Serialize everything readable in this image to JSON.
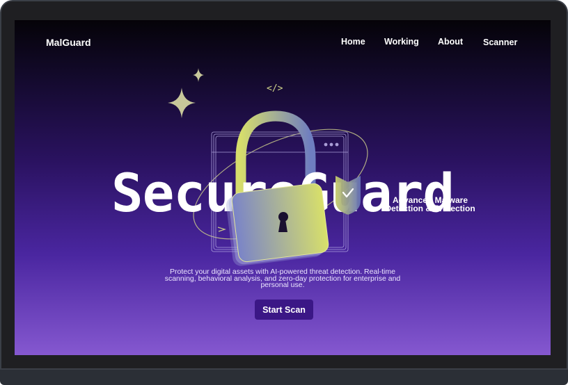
{
  "brand": "MalGuard",
  "nav": {
    "items": [
      {
        "label": "Home"
      },
      {
        "label": "Working"
      },
      {
        "label": "About"
      },
      {
        "label": "Scanner"
      }
    ]
  },
  "hero": {
    "title": "SecureGuard",
    "subtitle": "Advanced Malware Detection & Protection",
    "description": "Protect your digital assets with AI-powered threat detection. Real-time scanning, behavioral analysis, and zero-day protection for enterprise and personal use.",
    "cta_label": "Start Scan",
    "code_glyph": "</>"
  },
  "icons": [
    "sparkle-icon",
    "code-icon",
    "padlock-icon",
    "shield-check-icon",
    "browser-window-icon"
  ],
  "colors": {
    "accent": "#3b1786",
    "lock_gradient_start": "#7a84c8",
    "lock_gradient_end": "#d8e06a",
    "background_top": "#050308",
    "background_bottom": "#8558d0"
  }
}
